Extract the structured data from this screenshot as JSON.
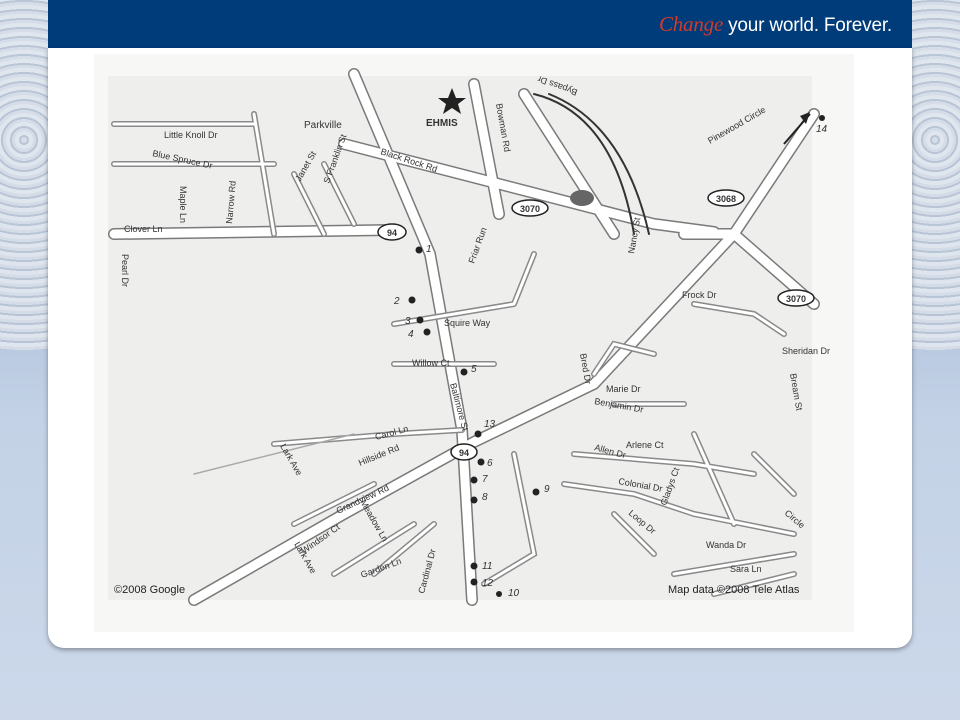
{
  "header": {
    "tagline_accent": "Change",
    "tagline_rest": "your world. Forever."
  },
  "map": {
    "copyright": "©2008 Google",
    "attribution": "Map data ©2008 Tele Atlas",
    "destination_label": "EHMIS",
    "place_labels": [
      "Parkville"
    ],
    "street_labels": [
      "Little Knoll Dr",
      "Blue Spruce Dr",
      "Narrow Rd",
      "Janet St",
      "S Franklin St",
      "Black Rock Rd",
      "Bowman Rd",
      "Clover Ln",
      "Maple Ln",
      "Pearl Dr",
      "Friar Run",
      "Squire Way",
      "Willow Ct",
      "Baltimore St",
      "Carol Ln",
      "Hillside Rd",
      "Grandview Rd",
      "Lark Ave",
      "Meadow Ln",
      "Windsor Ct",
      "Garden Ln",
      "Cardinal Dr",
      "Nancy St",
      "Bred Dr",
      "Marie Dr",
      "Benjamin Dr",
      "Allen Dr",
      "Arlene Ct",
      "Colonial Dr",
      "Gladys Ct",
      "Loop Dr",
      "Wanda Dr",
      "Sara Ln",
      "Frock Dr",
      "Pinewood Circle",
      "Bypass Dr",
      "Sheridan Dr",
      "Bream St",
      "Circle",
      "Lark Ave"
    ],
    "route_shields": [
      "94",
      "3070",
      "3068",
      "3070",
      "94"
    ],
    "markers": [
      "1",
      "2",
      "3",
      "4",
      "5",
      "13",
      "6",
      "7",
      "8",
      "9",
      "11",
      "12",
      "10",
      "14"
    ]
  },
  "icons": {
    "destination": "star-icon",
    "route": "arrow-icon"
  }
}
